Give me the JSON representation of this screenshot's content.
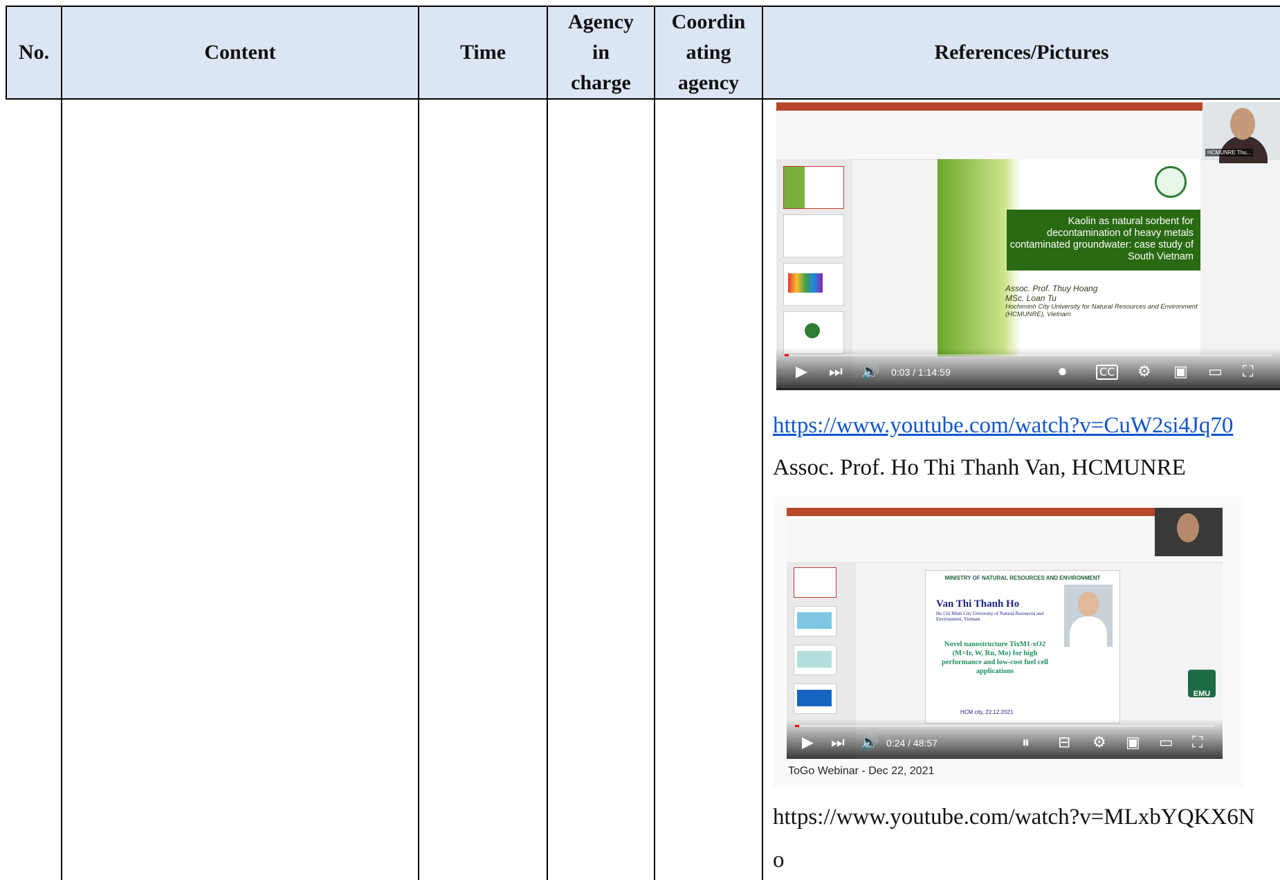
{
  "table": {
    "headers": {
      "no": "No.",
      "content": "Content",
      "time": "Time",
      "agency_line1": "Agency",
      "agency_line2": "in",
      "agency_line3": "charge",
      "coord_line1": "Coordin",
      "coord_line2": "ating",
      "coord_line3": "agency",
      "refs": "References/Pictures"
    }
  },
  "refs": {
    "video1": {
      "slide_title": "Kaolin as natural sorbent for decontamination of heavy metals contaminated groundwater: case study of South Vietnam",
      "author1": "Assoc. Prof. Thuy Hoang",
      "author2": "MSc. Loan Tu",
      "affiliation": "Hochiminh City University for Natural Resources and Environment (HCMUNRE), Vietnam",
      "time": "0:03 / 1:14:59",
      "cam_tag": "HCMUNRE Thu..."
    },
    "link1": "https://www.youtube.com/watch?v=CuW2si4Jq70",
    "presenter": "Assoc. Prof. Ho Thi Thanh Van, HCMUNRE",
    "video2": {
      "slide_head": "MINISTRY OF NATURAL RESOURCES AND ENVIRONMENT",
      "name": "Van Thi Thanh Ho",
      "affiliation": "Ho Chi Minh City University of Natural Resources and Environment, Vietnam",
      "title": "Novel nanostructure TixM1-xO2 (M=Ir, W, Ru, Mo) for high performance and low-cost fuel cell applications",
      "date": "HCM city, 22.12.2021",
      "time": "0:24 / 48:57",
      "caption": "ToGo Webinar - Dec 22, 2021",
      "logo": "EMU"
    },
    "link2_line1": "https://www.youtube.com/watch?v=MLxbYQKX6N",
    "link2_line2": "o"
  },
  "icons": [
    "play-icon",
    "next-icon",
    "volume-icon",
    "autoplay-toggle-icon",
    "captions-icon",
    "settings-icon",
    "miniplayer-icon",
    "theater-icon",
    "fullscreen-icon"
  ]
}
